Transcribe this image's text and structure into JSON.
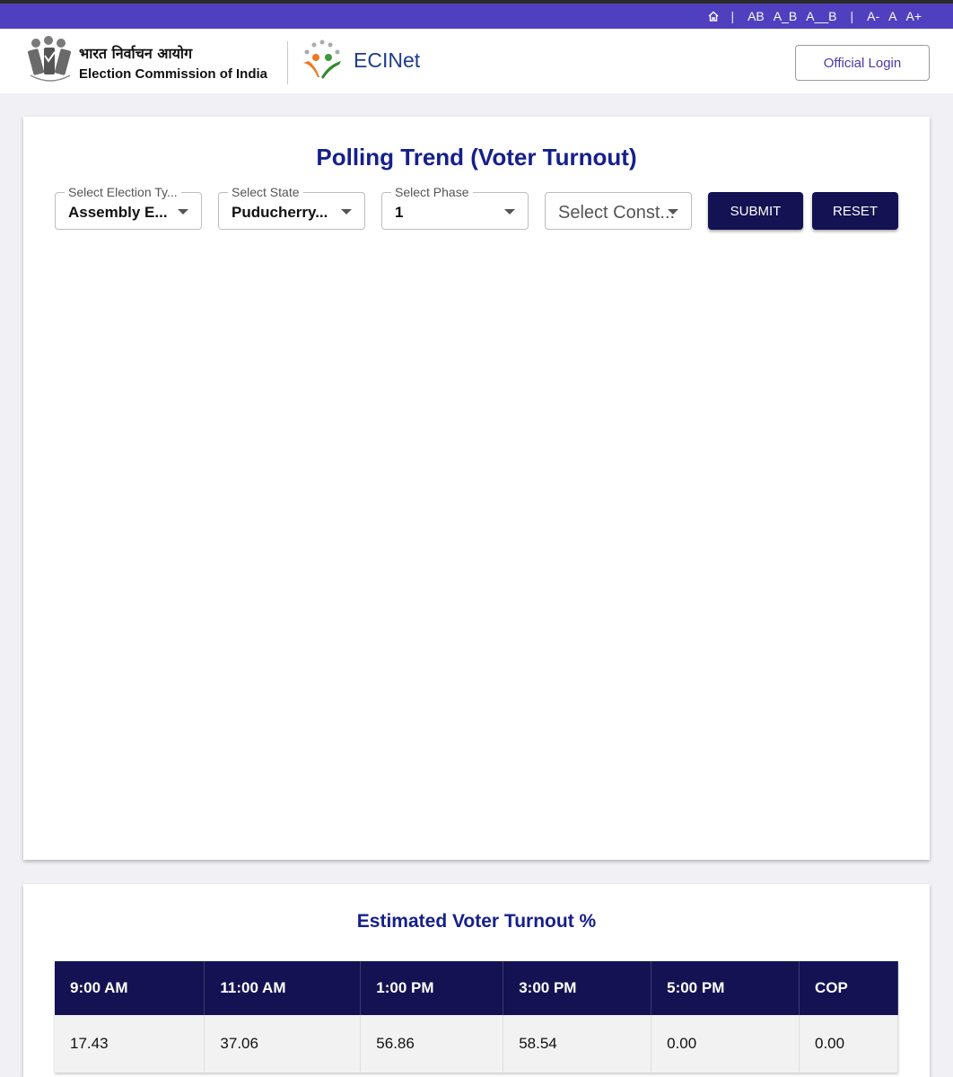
{
  "topbar": {
    "items": [
      "AB",
      "A_B",
      "A__B"
    ],
    "font_sizes": [
      "A-",
      "A",
      "A+"
    ],
    "separator": "|"
  },
  "header": {
    "org_hindi": "भारत निर्वाचन आयोग",
    "org_english": "Election Commission of India",
    "app_name": "ECINet",
    "login_label": "Official Login"
  },
  "polling": {
    "title": "Polling Trend (Voter Turnout)",
    "filters": [
      {
        "label": "Select Election Ty...",
        "value": "Assembly E..."
      },
      {
        "label": "Select State",
        "value": "Puducherry..."
      },
      {
        "label": "Select Phase",
        "value": "1"
      },
      {
        "label": "",
        "placeholder": "Select Const..."
      }
    ],
    "submit_label": "SUBMIT",
    "reset_label": "RESET"
  },
  "turnout": {
    "title": "Estimated Voter Turnout %",
    "columns": [
      "9:00 AM",
      "11:00 AM",
      "1:00 PM",
      "3:00 PM",
      "5:00 PM",
      "COP"
    ],
    "values": [
      "17.43",
      "37.06",
      "56.86",
      "58.54",
      "0.00",
      "0.00"
    ]
  },
  "colors": {
    "topbar": "#5040c0",
    "primary_dark": "#141252",
    "title_blue": "#16208a"
  }
}
